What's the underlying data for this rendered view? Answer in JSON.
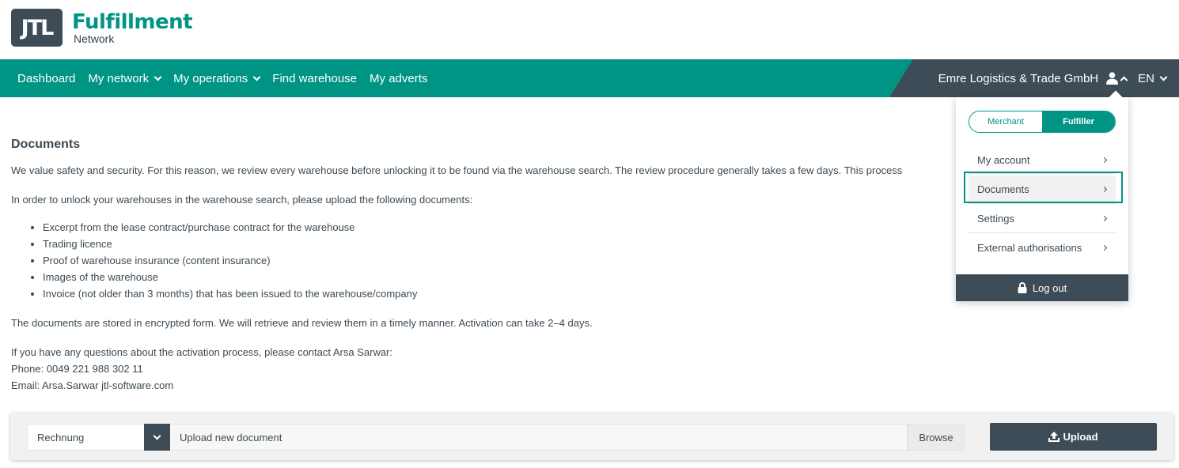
{
  "logo": {
    "mark": "JTL",
    "title": "Fulfillment",
    "subtitle": "Network"
  },
  "nav": {
    "items": [
      {
        "label": "Dashboard",
        "has_dropdown": false
      },
      {
        "label": "My network",
        "has_dropdown": true
      },
      {
        "label": "My operations",
        "has_dropdown": true
      },
      {
        "label": "Find warehouse",
        "has_dropdown": false
      },
      {
        "label": "My adverts",
        "has_dropdown": false
      }
    ],
    "company": "Emre Logistics & Trade GmbH",
    "user_icon": "user-icon",
    "language": "EN"
  },
  "page": {
    "title": "Documents",
    "intro": "We value safety and security. For this reason, we review every warehouse before unlocking it to be found via the warehouse search. The review procedure generally takes a few days. This process",
    "instruction": "In order to unlock your warehouses in the warehouse search, please upload the following documents:",
    "documents": [
      "Excerpt from the lease contract/purchase contract for the warehouse",
      "Trading licence",
      "Proof of warehouse insurance (content insurance)",
      "Images of the warehouse",
      "Invoice (not older than 3 months) that has been issued to the warehouse/company"
    ],
    "storage_note": "The documents are stored in encrypted form. We will retrieve and review them in a timely manner. Activation can take 2–4 days.",
    "contact_intro": "If you have any questions about the activation process, please contact Arsa Sarwar:",
    "phone": "Phone: 0049 221 988 302 11",
    "email": "Email: Arsa.Sarwar jtl-software.com"
  },
  "upload": {
    "doc_type": "Rechnung",
    "placeholder": "Upload new document",
    "browse_label": "Browse",
    "upload_label": "Upload"
  },
  "dropdown": {
    "roles": {
      "merchant": "Merchant",
      "fulfiller": "Fulfiller",
      "selected": "Fulfiller"
    },
    "items": [
      {
        "label": "My account"
      },
      {
        "label": "Documents",
        "active": true
      },
      {
        "label": "Settings"
      },
      {
        "label": "External authorisations"
      }
    ],
    "logout_label": "Log out"
  },
  "colors": {
    "brand": "#009485",
    "dark": "#3d4c56",
    "text": "#3b4a55"
  }
}
